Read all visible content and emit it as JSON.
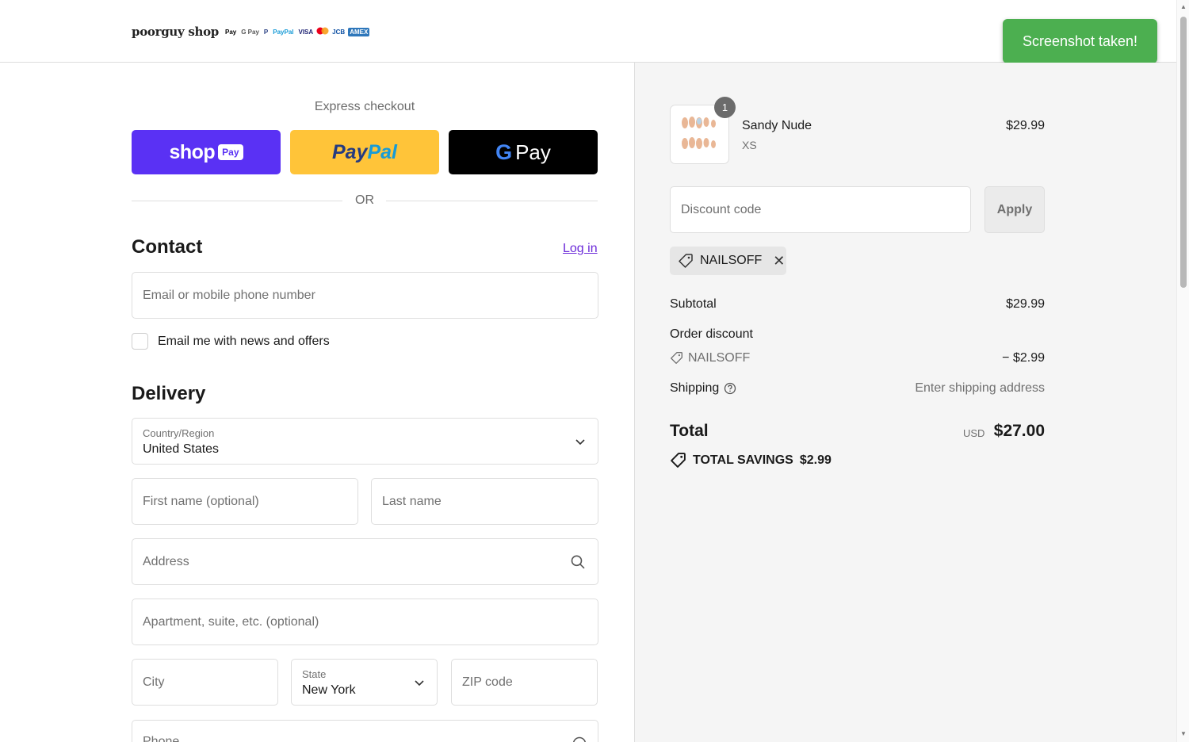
{
  "header": {
    "logo_text": "poorguy shop",
    "badges": [
      "Pay",
      "G Pay",
      "P",
      "PayPal",
      "VISA",
      "JCB",
      "AMEX"
    ]
  },
  "toast": {
    "text": "Screenshot taken!"
  },
  "express": {
    "label": "Express checkout",
    "shop_pay": {
      "word": "shop",
      "badge": "Pay"
    },
    "paypal": {
      "part1": "Pay",
      "part2": "Pal"
    },
    "gpay": {
      "g": "G",
      "word": "Pay"
    },
    "or": "OR"
  },
  "contact": {
    "title": "Contact",
    "login": "Log in",
    "email_placeholder": "Email or mobile phone number",
    "newsletter_label": "Email me with news and offers"
  },
  "delivery": {
    "title": "Delivery",
    "country_label": "Country/Region",
    "country_value": "United States",
    "first_name_placeholder": "First name (optional)",
    "last_name_placeholder": "Last name",
    "address_placeholder": "Address",
    "apartment_placeholder": "Apartment, suite, etc. (optional)",
    "city_placeholder": "City",
    "state_label": "State",
    "state_value": "New York",
    "zip_placeholder": "ZIP code",
    "phone_placeholder": "Phone"
  },
  "summary": {
    "item": {
      "name": "Sandy Nude",
      "variant": "XS",
      "price": "$29.99",
      "quantity": "1"
    },
    "discount_placeholder": "Discount code",
    "apply_label": "Apply",
    "applied_code": "NAILSOFF",
    "subtotal_label": "Subtotal",
    "subtotal_value": "$29.99",
    "order_discount_label": "Order discount",
    "discount_code": "NAILSOFF",
    "discount_value": "− $2.99",
    "shipping_label": "Shipping",
    "shipping_value": "Enter shipping address",
    "total_label": "Total",
    "total_currency": "USD",
    "total_value": "$27.00",
    "savings_label": "TOTAL SAVINGS",
    "savings_value": "$2.99"
  },
  "colors": {
    "shop_pay": "#5a31f4",
    "paypal": "#ffc439",
    "gpay": "#000000",
    "link": "#6c2bd9",
    "toast": "#4caf50"
  }
}
